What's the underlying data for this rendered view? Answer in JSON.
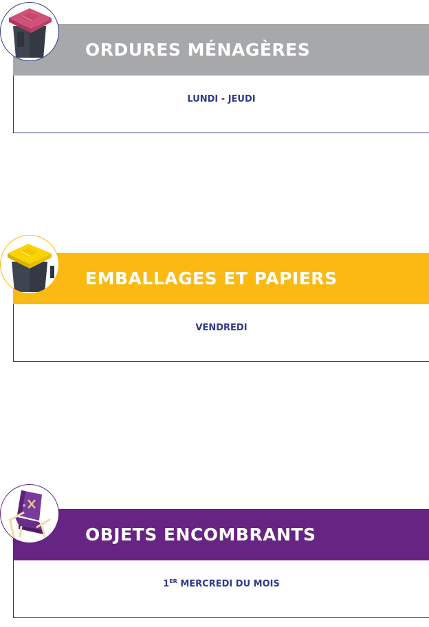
{
  "cards": [
    {
      "title": "ORDURES MÉNAGÈRES",
      "schedule": "LUNDI - JEUDI",
      "icon": "household-waste-bin-icon",
      "header_color": "#a7a8aa",
      "bin_lid_color": "#c8466b"
    },
    {
      "title": "EMBALLAGES ET PAPIERS",
      "schedule": "VENDREDI",
      "icon": "recycling-bin-icon",
      "header_color": "#fbba12",
      "bin_lid_color": "#fbd400"
    },
    {
      "title": "OBJETS ENCOMBRANTS",
      "schedule_ordinal": "1",
      "schedule_sup": "ER",
      "schedule": "MERCREDI DU MOIS",
      "icon": "armchair-icon",
      "header_color": "#662483"
    }
  ],
  "colors": {
    "text_blue": "#2e3a8c"
  }
}
